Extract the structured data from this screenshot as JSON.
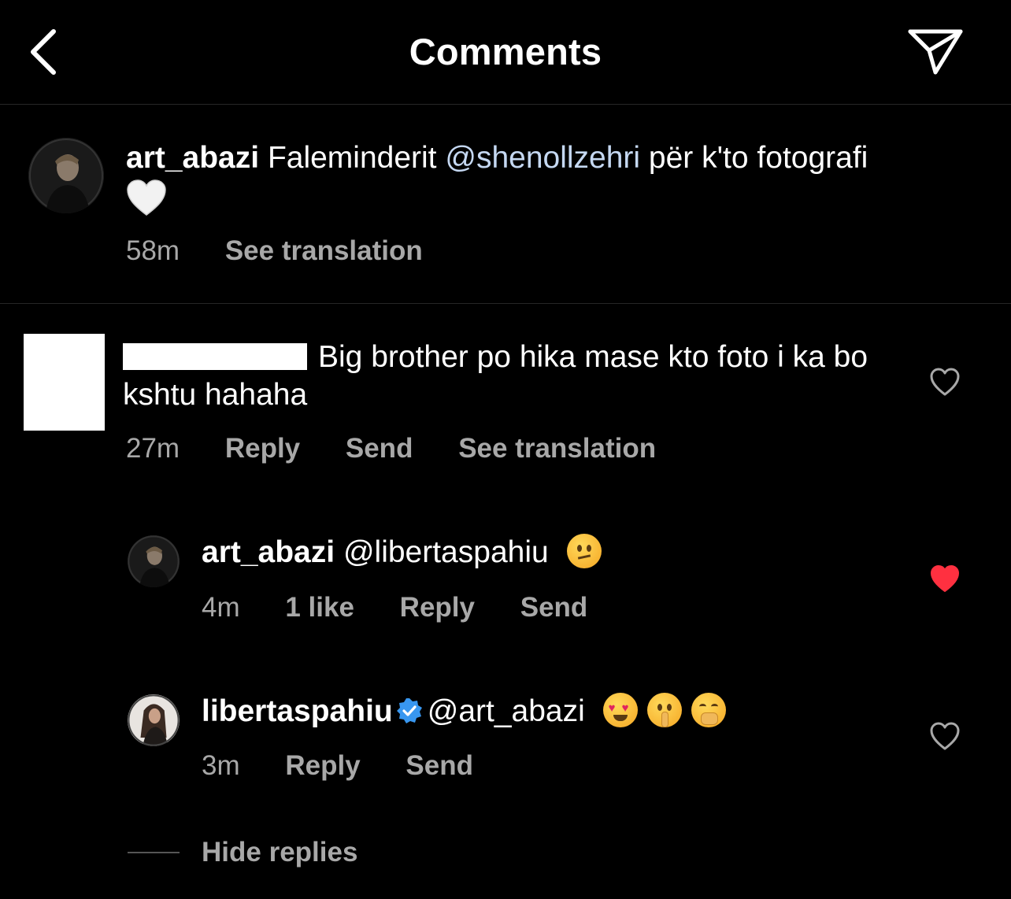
{
  "header": {
    "title": "Comments",
    "back_icon": "chevron-left-icon",
    "share_icon": "paper-plane-icon"
  },
  "caption": {
    "username": "art_abazi",
    "text_before": "Faleminderit ",
    "mention": "@shenollzehri",
    "text_after": " për k'to fotografi",
    "emoji": "white-heart",
    "time": "58m",
    "see_translation": "See translation"
  },
  "comments": [
    {
      "username_redacted": true,
      "text": "Big brother po hika mase kto foto i ka bo kshtu hahaha",
      "time": "27m",
      "reply": "Reply",
      "send": "Send",
      "see_translation": "See translation",
      "liked": false,
      "replies": [
        {
          "username": "art_abazi",
          "mention": "@libertaspahiu",
          "emoji": "thinking-face",
          "time": "4m",
          "likes": "1 like",
          "reply": "Reply",
          "send": "Send",
          "liked": true
        },
        {
          "username": "libertaspahiu",
          "verified": true,
          "mention": "@art_abazi",
          "emojis": [
            "heart-eyes",
            "shushing-face",
            "hand-over-mouth"
          ],
          "time": "3m",
          "reply": "Reply",
          "send": "Send",
          "liked": false
        }
      ]
    }
  ],
  "hide_replies": "Hide replies",
  "colors": {
    "background": "#000000",
    "text": "#ffffff",
    "secondary": "#a8a8a8",
    "mention": "#c5d8f2",
    "like_active": "#ff3040",
    "verified": "#3897f0"
  }
}
